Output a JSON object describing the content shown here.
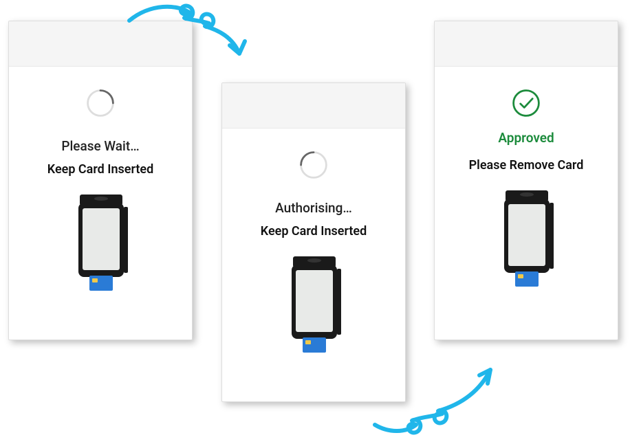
{
  "panels": [
    {
      "status": "Please Wait…",
      "sub": "Keep Card Inserted",
      "state": "spinner"
    },
    {
      "status": "Authorising…",
      "sub": "Keep Card Inserted",
      "state": "spinner"
    },
    {
      "status": "Approved",
      "sub": "Please Remove Card",
      "state": "approved"
    }
  ],
  "colors": {
    "arrow": "#20b6ea",
    "approved": "#1c8b3c"
  }
}
